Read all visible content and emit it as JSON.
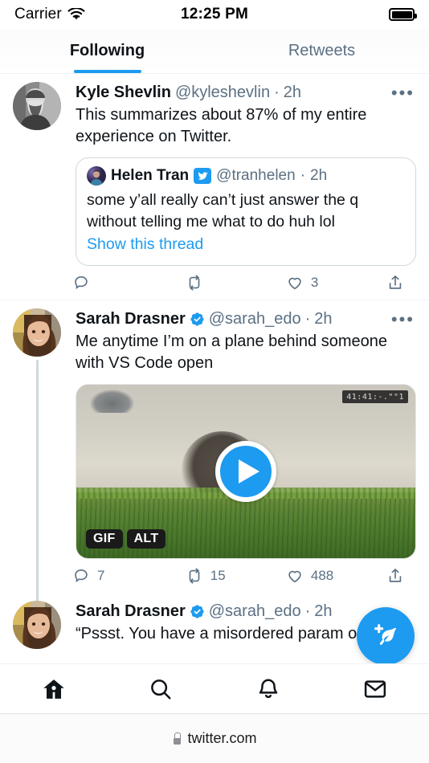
{
  "status_bar": {
    "carrier": "Carrier",
    "wifi_icon": "wifi-icon",
    "time": "12:25 PM",
    "battery_icon": "battery-full-icon"
  },
  "tabs": [
    {
      "label": "Following",
      "active": true
    },
    {
      "label": "Retweets",
      "active": false
    }
  ],
  "theme": {
    "accent": "#1d9bf0",
    "text": "#0f1419",
    "muted": "#5b7083",
    "border": "#cfd9de"
  },
  "tweets": [
    {
      "display_name": "Kyle Shevlin",
      "handle": "@kyleshevlin",
      "separator_dot": "·",
      "timestamp": "2h",
      "verified": false,
      "more_label": "•••",
      "text": "This summarizes about 87% of my entire experience on Twitter.",
      "quote": {
        "display_name": "Helen Tran",
        "badge": "twitter-bird-badge",
        "handle": "@tranhelen",
        "separator_dot": "·",
        "timestamp": "2h",
        "text": "some y’all really can’t just answer the q without telling me what to do huh lol",
        "link_label": "Show this thread"
      },
      "actions": {
        "reply_count": "",
        "retweet_count": "",
        "like_count": "3",
        "share_count": ""
      }
    },
    {
      "display_name": "Sarah Drasner",
      "handle": "@sarah_edo",
      "separator_dot": "·",
      "timestamp": "2h",
      "verified": true,
      "more_label": "•••",
      "text": "Me anytime I’m on a plane behind someone with VS Code open",
      "media": {
        "type": "gif",
        "gif_badge": "GIF",
        "alt_badge": "ALT",
        "play_button": "play-icon",
        "watermark": "41:41:-.\"\"1"
      },
      "actions": {
        "reply_count": "7",
        "retweet_count": "15",
        "like_count": "488",
        "share_count": ""
      }
    },
    {
      "display_name": "Sarah Drasner",
      "handle": "@sarah_edo",
      "separator_dot": "·",
      "timestamp": "2h",
      "verified": true,
      "text": "“Pssst. You have a misordered param on lin"
    }
  ],
  "compose_fab": {
    "icon": "compose-feather-plus-icon"
  },
  "bottom_nav": [
    {
      "icon": "home-icon",
      "active": true
    },
    {
      "icon": "search-icon",
      "active": false
    },
    {
      "icon": "notifications-bell-icon",
      "active": false
    },
    {
      "icon": "messages-envelope-icon",
      "active": false
    }
  ],
  "browser_bar": {
    "lock_icon": "lock-icon",
    "domain": "twitter.com"
  }
}
